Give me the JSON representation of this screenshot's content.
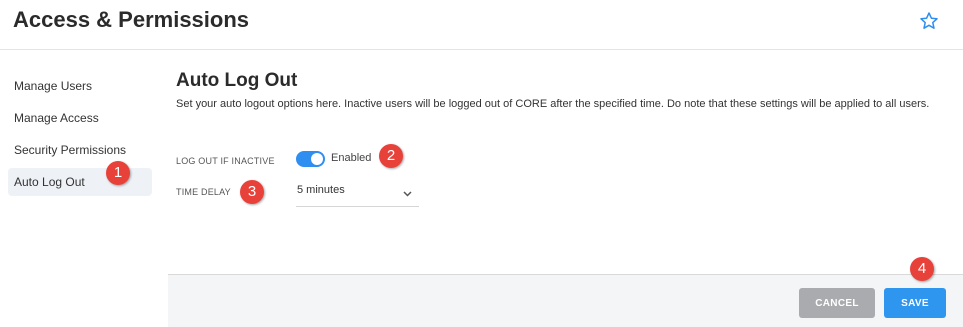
{
  "header": {
    "title": "Access & Permissions",
    "favorite_icon": "star-icon"
  },
  "sidebar": {
    "items": [
      {
        "label": "Manage Users",
        "active": false
      },
      {
        "label": "Manage Access",
        "active": false
      },
      {
        "label": "Security Permissions",
        "active": false
      },
      {
        "label": "Auto Log Out",
        "active": true
      }
    ]
  },
  "main": {
    "title": "Auto Log Out",
    "description": "Set your auto logout options here. Inactive users will be logged out of CORE after the specified time. Do note that these settings will be applied to all users.",
    "logout_inactive": {
      "label": "LOG OUT IF INACTIVE",
      "toggle_state": "Enabled",
      "enabled": true
    },
    "time_delay": {
      "label": "TIME DELAY",
      "value": "5 minutes"
    }
  },
  "footer": {
    "cancel_label": "CANCEL",
    "save_label": "SAVE"
  },
  "callouts": [
    "1",
    "2",
    "3",
    "4"
  ],
  "colors": {
    "accent": "#2f96ef",
    "callout": "#e8413a",
    "cancel": "#a9abae"
  }
}
